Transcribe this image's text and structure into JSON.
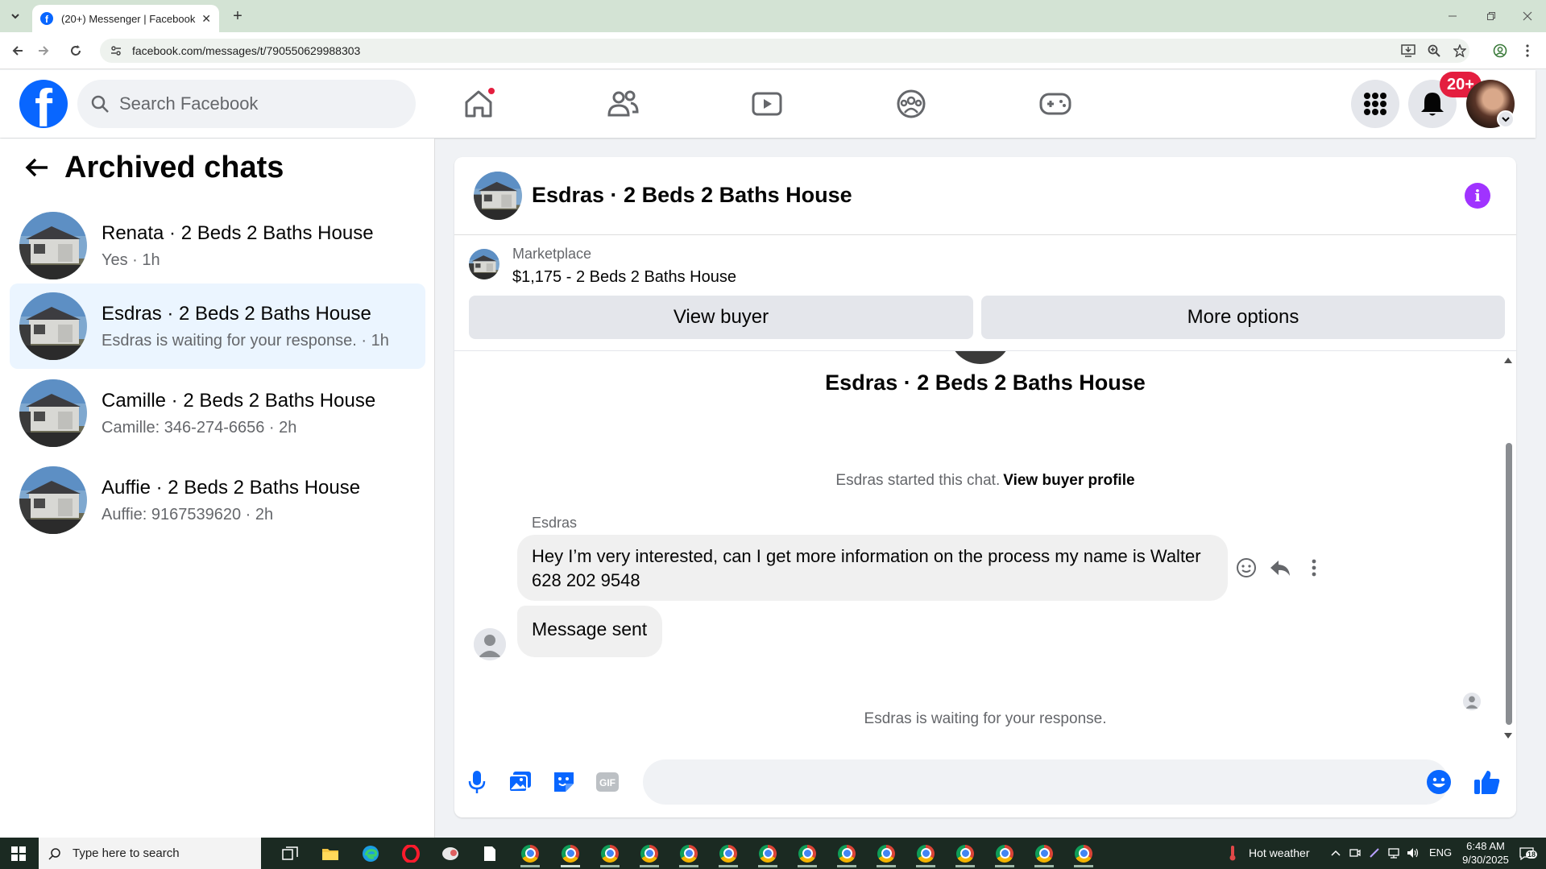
{
  "browser": {
    "tab_title": "(20+) Messenger | Facebook",
    "tab_close": "✕",
    "new_tab": "+",
    "url": "facebook.com/messages/t/790550629988303"
  },
  "fb_header": {
    "search_placeholder": "Search Facebook",
    "notification_badge": "20+",
    "brand_color": "#0866ff"
  },
  "sidebar": {
    "title": "Archived chats",
    "chats": [
      {
        "name": "Renata · 2 Beds 2 Baths House",
        "preview": "Yes · 1h",
        "active": false
      },
      {
        "name": "Esdras · 2 Beds 2 Baths House",
        "preview": "Esdras is waiting for your response. · 1h",
        "active": true
      },
      {
        "name": "Camille · 2 Beds 2 Baths House",
        "preview": "Camille: 346-274-6656 · 2h",
        "active": false
      },
      {
        "name": "Auffie · 2 Beds 2 Baths House",
        "preview": "Auffie: 9167539620 · 2h",
        "active": false
      }
    ]
  },
  "conversation": {
    "title": "Esdras · 2 Beds 2 Baths House",
    "marketplace_label": "Marketplace",
    "listing": "$1,175 - 2 Beds 2 Baths House",
    "view_buyer_button": "View buyer",
    "more_options_button": "More options",
    "intro_name": "Esdras · 2 Beds 2 Baths House",
    "started_text": "Esdras started this chat.",
    "view_buyer_profile_link": "View buyer profile",
    "sender_name": "Esdras",
    "messages": [
      {
        "text": "Hey I’m very interested, can I get more information on the process my name is Walter 628 202 9548"
      },
      {
        "text": "Message sent"
      }
    ],
    "waiting_text": "Esdras is waiting for your response.",
    "composer_placeholder": ""
  },
  "taskbar": {
    "search_placeholder": "Type here to search",
    "weather": "Hot weather",
    "language": "ENG",
    "time": "6:48 AM",
    "date": "9/30/2025",
    "notification_count": "18"
  },
  "icons": {
    "home": "home-icon",
    "friends": "friends-icon",
    "video": "video-icon",
    "groups": "groups-icon",
    "gaming": "gaming-icon",
    "menu": "menu-grid-icon",
    "bell": "bell-icon",
    "info": "info-icon",
    "mic": "microphone-icon",
    "photo": "photo-icon",
    "sticker": "sticker-icon",
    "gif": "gif-icon",
    "emoji": "emoji-icon",
    "like": "thumbs-up-icon"
  }
}
